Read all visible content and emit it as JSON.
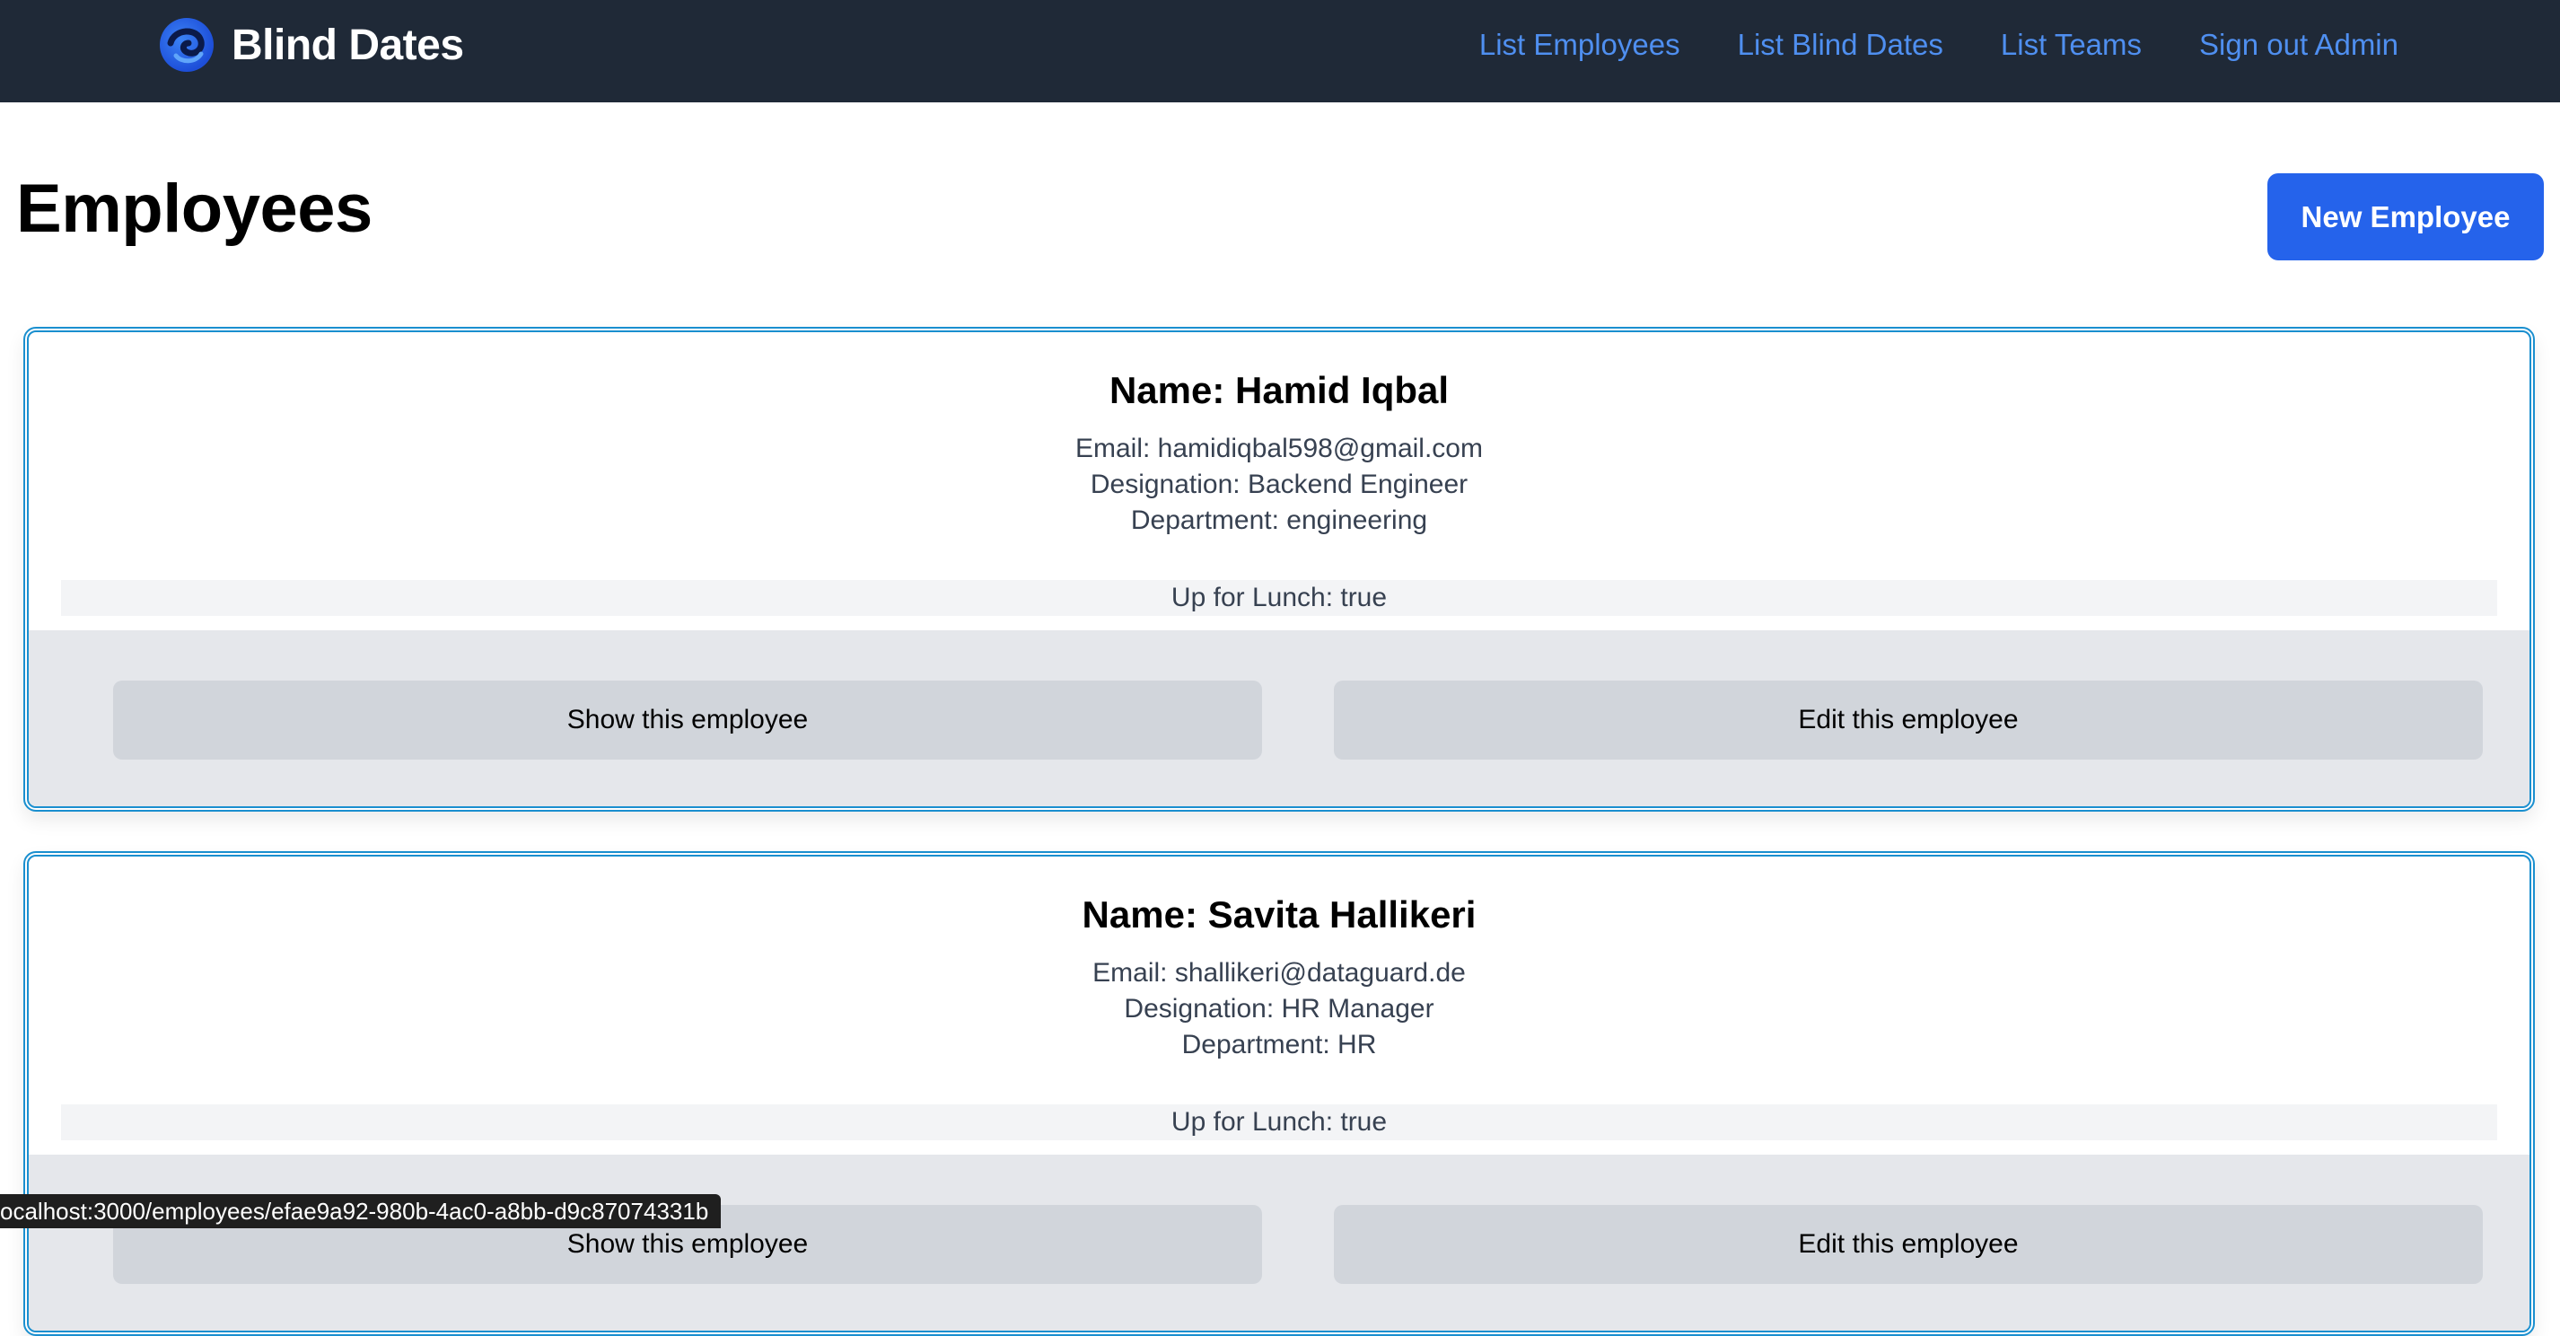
{
  "navbar": {
    "brand_title": "Blind Dates",
    "links": [
      {
        "label": "List Employees"
      },
      {
        "label": "List Blind Dates"
      },
      {
        "label": "List Teams"
      },
      {
        "label": "Sign out Admin"
      }
    ]
  },
  "page": {
    "title": "Employees",
    "new_button_label": "New Employee"
  },
  "employees": [
    {
      "name": "Name: Hamid Iqbal",
      "email": "Email: hamidiqbal598@gmail.com",
      "designation": "Designation: Backend Engineer",
      "department": "Department: engineering",
      "lunch": "Up for Lunch: true",
      "show_label": "Show this employee",
      "edit_label": "Edit this employee"
    },
    {
      "name": "Name: Savita Hallikeri",
      "email": "Email: shallikeri@dataguard.de",
      "designation": "Designation: HR Manager",
      "department": "Department: HR",
      "lunch": "Up for Lunch: true",
      "show_label": "Show this employee",
      "edit_label": "Edit this employee"
    }
  ],
  "status_bar": {
    "url": "ocalhost:3000/employees/efae9a92-980b-4ac0-a8bb-d9c87074331b"
  },
  "colors": {
    "navbar_bg": "#1f2937",
    "nav_link": "#4f8ff0",
    "primary_button": "#2563eb",
    "card_border": "#1a8fcf",
    "actions_bg": "#e5e7eb",
    "action_button": "#d1d5db"
  }
}
